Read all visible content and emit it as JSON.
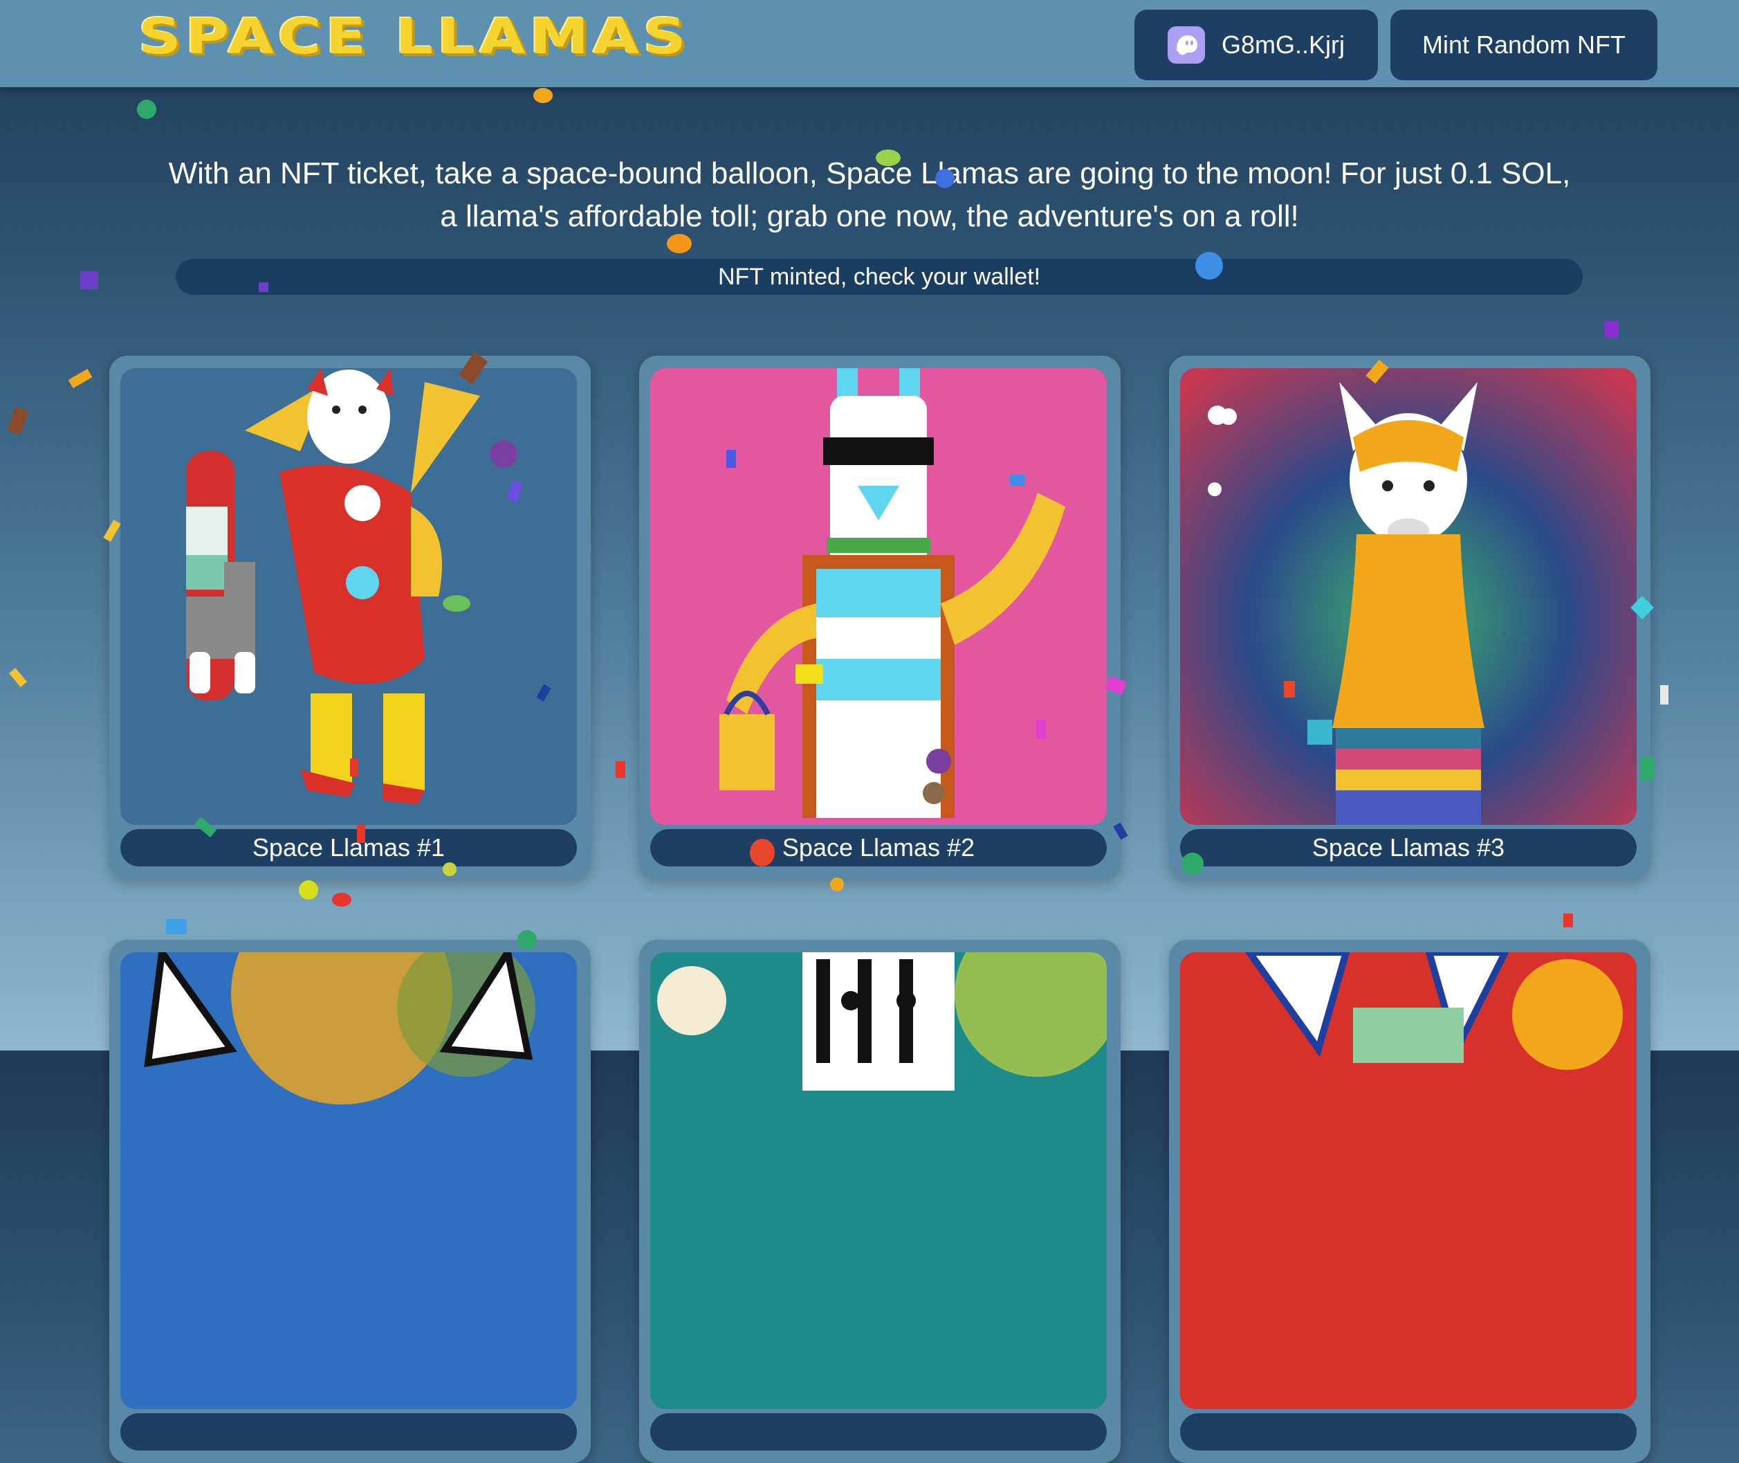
{
  "header": {
    "logo_text": "SPACE LLAMAS",
    "wallet_label": "G8mG..Kjrj",
    "wallet_icon": "phantom-ghost-icon",
    "mint_label": "Mint Random NFT"
  },
  "intro": {
    "text": "With an NFT ticket, take a space-bound balloon, Space Llamas are going to the moon! For just 0.1 SOL, a llama's affordable toll; grab one now, the adventure's on a roll!",
    "status": "NFT minted, check your wallet!"
  },
  "gallery": {
    "items": [
      {
        "label": "Space Llamas #1"
      },
      {
        "label": "Space Llamas #2"
      },
      {
        "label": "Space Llamas #3"
      },
      {
        "label": ""
      },
      {
        "label": ""
      },
      {
        "label": ""
      }
    ]
  },
  "colors": {
    "header": "#5e90b0",
    "button": "#1d3f64",
    "logo": "#f5d430",
    "card": "#5a89a8"
  }
}
